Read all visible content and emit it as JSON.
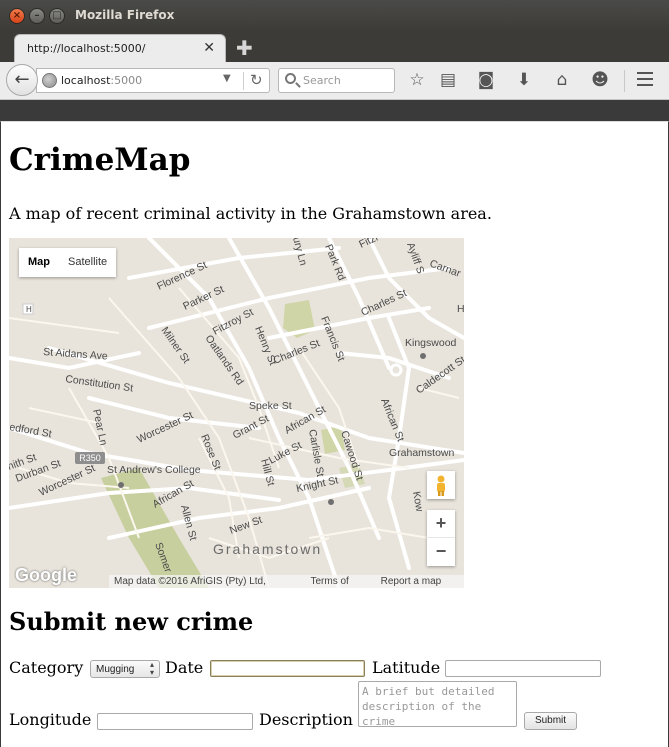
{
  "window": {
    "title": "Mozilla Firefox"
  },
  "tab": {
    "title": "http://localhost:5000/"
  },
  "navbar": {
    "url_host": "localhost",
    "url_port": ":5000",
    "search_placeholder": "Search"
  },
  "page": {
    "heading": "CrimeMap",
    "lead": "A map of recent criminal activity in the Grahamstown area.",
    "map": {
      "type_map": "Map",
      "type_satellite": "Satellite",
      "attribution": "Map data ©2016 AfriGIS (Pty) Ltd, Google",
      "terms": "Terms of Use",
      "report": "Report a map error",
      "logo": "Google",
      "zoom_in": "+",
      "zoom_out": "−",
      "labels": {
        "florence": "Florence St",
        "parker": "Parker St",
        "fitzroy": "Fitzroy St",
        "henry": "Henry St",
        "oatlands": "Oatlands Rd",
        "milner": "Milner St",
        "staidans": "St Aidans Ave",
        "constitution": "Constitution St",
        "charles1": "Charles St",
        "charles2": "Charles St",
        "francis": "Francis St",
        "kingswood": "Kingswood",
        "caldecott": "Caldecott St",
        "speke": "Speke St",
        "grant": "Grant St",
        "african1": "African St",
        "african2": "African St",
        "african3": "African St",
        "worcester1": "Worcester St",
        "worcester2": "Worcester St",
        "rose": "Rose St",
        "carlisle": "Carlisle St",
        "cawood": "Cawood St",
        "luke": "Luke St",
        "hill": "Hill St",
        "knight": "Knight St",
        "standrews": "St Andrew's College",
        "allen": "Allen St",
        "new": "New St",
        "durban": "Durban St",
        "pear": "Pear Ln",
        "bedford": "edford St",
        "smith": "nith St",
        "r350": "R350",
        "grahamstown": "Grahamstown",
        "grahamstown2": "Grahamstown",
        "park": "Park Rd",
        "ayliff": "Ayliff S",
        "carnar": "Carnar",
        "rury": "ury Ln",
        "fitzr": "Fitzr",
        "somer": "Somer",
        "kow": "Kow",
        "h1": "H",
        "h2": "Ha"
      }
    },
    "form": {
      "heading": "Submit new crime",
      "category_label": "Category",
      "category_value": "Mugging",
      "date_label": "Date",
      "latitude_label": "Latitude",
      "longitude_label": "Longitude",
      "description_label": "Description",
      "description_placeholder": "A brief but detailed description of the crime",
      "submit_label": "Submit"
    }
  }
}
